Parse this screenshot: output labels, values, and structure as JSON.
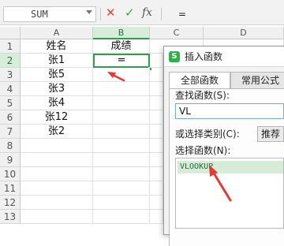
{
  "formula_bar": {
    "name_box": "SUM",
    "cancel_symbol": "✕",
    "enter_symbol": "✓",
    "fx_symbol": "fx",
    "formula": "="
  },
  "columns": [
    "A",
    "B",
    "C",
    "D"
  ],
  "rows": [
    "1",
    "2",
    "3",
    "4",
    "5",
    "6",
    "7",
    "8",
    "9",
    "10",
    "11",
    "12",
    "13"
  ],
  "cells": {
    "a": [
      "姓名",
      "张1",
      "张5",
      "张3",
      "张4",
      "张12",
      "张2"
    ],
    "b": [
      "成绩",
      "="
    ]
  },
  "selected": {
    "column": "B",
    "row": "2"
  },
  "dialog": {
    "logo": "S",
    "title": "插入函数",
    "tabs": [
      "全部函数",
      "常用公式"
    ],
    "search_label": "查找函数(S):",
    "search_value": "VL",
    "category_label": "或选择类别(C):",
    "category_value": "推荐",
    "select_label": "选择函数(N):",
    "functions": [
      "VLOOKUP"
    ]
  },
  "colors": {
    "accent": "#2e9b4f",
    "annotation_arrow": "#e53935",
    "selected_function_bg": "#d5ecd7"
  }
}
